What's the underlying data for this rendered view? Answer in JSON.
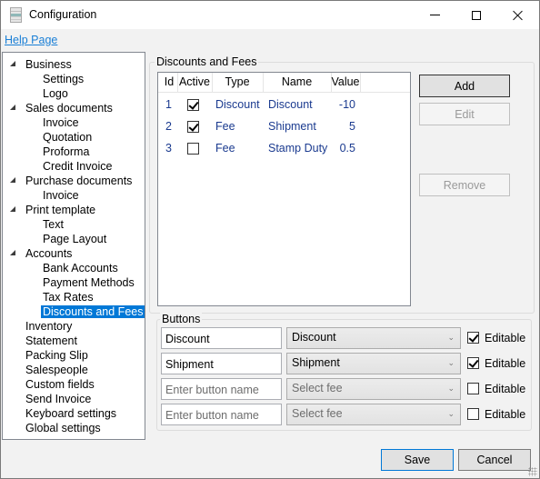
{
  "window": {
    "title": "Configuration",
    "icon": "document-icon",
    "controls": [
      "minimize",
      "maximize",
      "close"
    ]
  },
  "help_link": "Help Page",
  "tree": [
    {
      "label": "Business",
      "level": 0,
      "expanded": true
    },
    {
      "label": "Settings",
      "level": 1
    },
    {
      "label": "Logo",
      "level": 1
    },
    {
      "label": "Sales documents",
      "level": 0,
      "expanded": true
    },
    {
      "label": "Invoice",
      "level": 1
    },
    {
      "label": "Quotation",
      "level": 1
    },
    {
      "label": "Proforma",
      "level": 1
    },
    {
      "label": "Credit Invoice",
      "level": 1
    },
    {
      "label": "Purchase documents",
      "level": 0,
      "expanded": true
    },
    {
      "label": "Invoice",
      "level": 1
    },
    {
      "label": "Print template",
      "level": 0,
      "expanded": true
    },
    {
      "label": "Text",
      "level": 1
    },
    {
      "label": "Page Layout",
      "level": 1
    },
    {
      "label": "Accounts",
      "level": 0,
      "expanded": true
    },
    {
      "label": "Bank Accounts",
      "level": 1
    },
    {
      "label": "Payment Methods",
      "level": 1
    },
    {
      "label": "Tax Rates",
      "level": 1
    },
    {
      "label": "Discounts and Fees",
      "level": 1,
      "selected": true
    },
    {
      "label": "Inventory",
      "level": 0
    },
    {
      "label": "Statement",
      "level": 0
    },
    {
      "label": "Packing Slip",
      "level": 0
    },
    {
      "label": "Salespeople",
      "level": 0
    },
    {
      "label": "Custom fields",
      "level": 0
    },
    {
      "label": "Send Invoice",
      "level": 0
    },
    {
      "label": "Keyboard settings",
      "level": 0
    },
    {
      "label": "Global settings",
      "level": 0
    }
  ],
  "discounts_group": {
    "title": "Discounts and Fees",
    "columns": [
      "Id",
      "Active",
      "Type",
      "Name",
      "Value"
    ],
    "rows": [
      {
        "id": "1",
        "active": true,
        "type": "Discount",
        "name": "Discount",
        "value": "-10"
      },
      {
        "id": "2",
        "active": true,
        "type": "Fee",
        "name": "Shipment",
        "value": "5"
      },
      {
        "id": "3",
        "active": false,
        "type": "Fee",
        "name": "Stamp Duty",
        "value": "0.5"
      }
    ],
    "add_label": "Add",
    "edit_label": "Edit",
    "remove_label": "Remove"
  },
  "buttons_group": {
    "title": "Buttons",
    "editable_label": "Editable",
    "rows": [
      {
        "name_value": "Discount",
        "name_placeholder": "Enter button name",
        "fee_value": "Discount",
        "fee_placeholder": "Select fee",
        "editable": true
      },
      {
        "name_value": "Shipment",
        "name_placeholder": "Enter button name",
        "fee_value": "Shipment",
        "fee_placeholder": "Select fee",
        "editable": true
      },
      {
        "name_value": "",
        "name_placeholder": "Enter button name",
        "fee_value": "",
        "fee_placeholder": "Select fee",
        "editable": false
      },
      {
        "name_value": "",
        "name_placeholder": "Enter button name",
        "fee_value": "",
        "fee_placeholder": "Select fee",
        "editable": false
      }
    ]
  },
  "footer": {
    "save_label": "Save",
    "cancel_label": "Cancel"
  },
  "colors": {
    "selection": "#0078d7",
    "link": "#1a7fd6",
    "grid_text": "#1a3a8f"
  }
}
